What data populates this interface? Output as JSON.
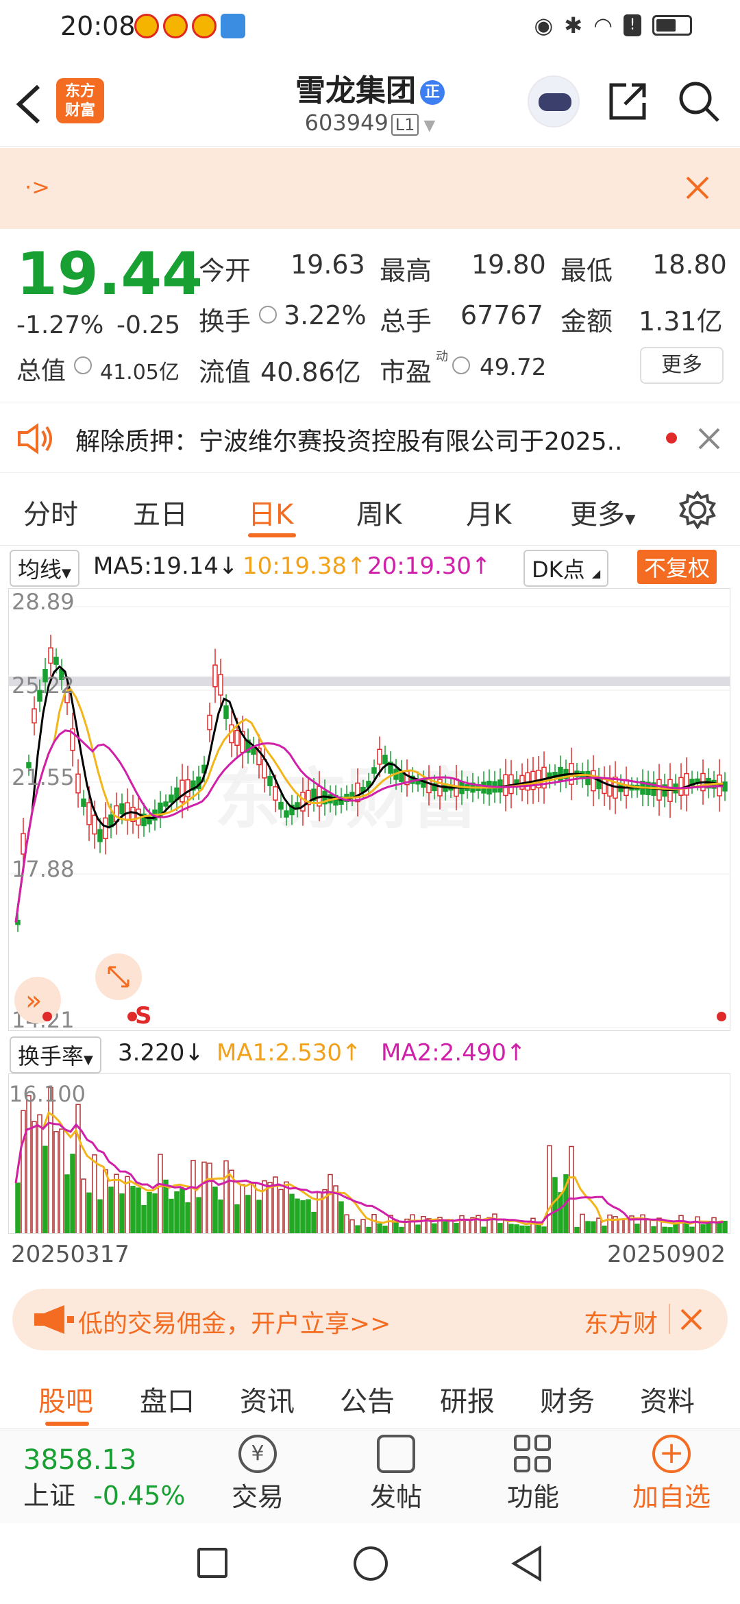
{
  "status": {
    "time": "20:08"
  },
  "header": {
    "logo_text": "东方财富",
    "title": "雪龙集团",
    "badge": "正",
    "code": "603949",
    "level": "L1"
  },
  "banner": {
    "text": "·>"
  },
  "quote": {
    "price": "19.44",
    "change_pct": "-1.27%",
    "change": "-0.25",
    "open_label": "今开",
    "open": "19.63",
    "high_label": "最高",
    "high": "19.80",
    "low_label": "最低",
    "low": "18.80",
    "turnover_label": "换手",
    "turnover": "3.22%",
    "vol_label": "总手",
    "vol": "67767",
    "amount_label": "金额",
    "amount": "1.31亿",
    "mktcap_label": "总值",
    "mktcap": "41.05亿",
    "float_label": "流值",
    "float": "40.86亿",
    "pe_label": "市盈",
    "pe_sup": "动",
    "pe": "49.72",
    "more": "更多"
  },
  "notice": {
    "text": "解除质押：宁波维尔赛投资控股有限公司于2025.."
  },
  "ktabs": [
    "分时",
    "五日",
    "日K",
    "周K",
    "月K",
    "更多"
  ],
  "ma": {
    "select": "均线",
    "ma5": "MA5:19.14↓",
    "ma10": "10:19.38↑",
    "ma20": "20:19.30↑",
    "dk": "DK点",
    "fq": "不复权"
  },
  "kchart": {
    "y_labels": [
      "28.89",
      "25.22",
      "21.55",
      "17.88",
      "14.21"
    ],
    "watermark": "东方财富",
    "s_marker": "S"
  },
  "vol": {
    "select": "换手率",
    "val": "3.220↓",
    "ma1": "MA1:2.530↑",
    "ma2": "MA2:2.490↑",
    "top": "16.100"
  },
  "dates": {
    "start": "20250317",
    "end": "20250902"
  },
  "promo": {
    "text": "低的交易佣金，开户立享>>",
    "brand": "东方财"
  },
  "tabs2": [
    "股吧",
    "盘口",
    "资讯",
    "公告",
    "研报",
    "财务",
    "资料"
  ],
  "footer": {
    "index_val": "3858.13",
    "index_name": "上证",
    "index_chg": "-0.45%",
    "trade": "交易",
    "post": "发帖",
    "func": "功能",
    "add": "加自选"
  },
  "colors": {
    "accent": "#f36c21",
    "up": "#e02a2a",
    "down": "#18a033",
    "ma5": "#000000",
    "ma10": "#f2b51a",
    "ma20": "#d01fa8"
  }
}
